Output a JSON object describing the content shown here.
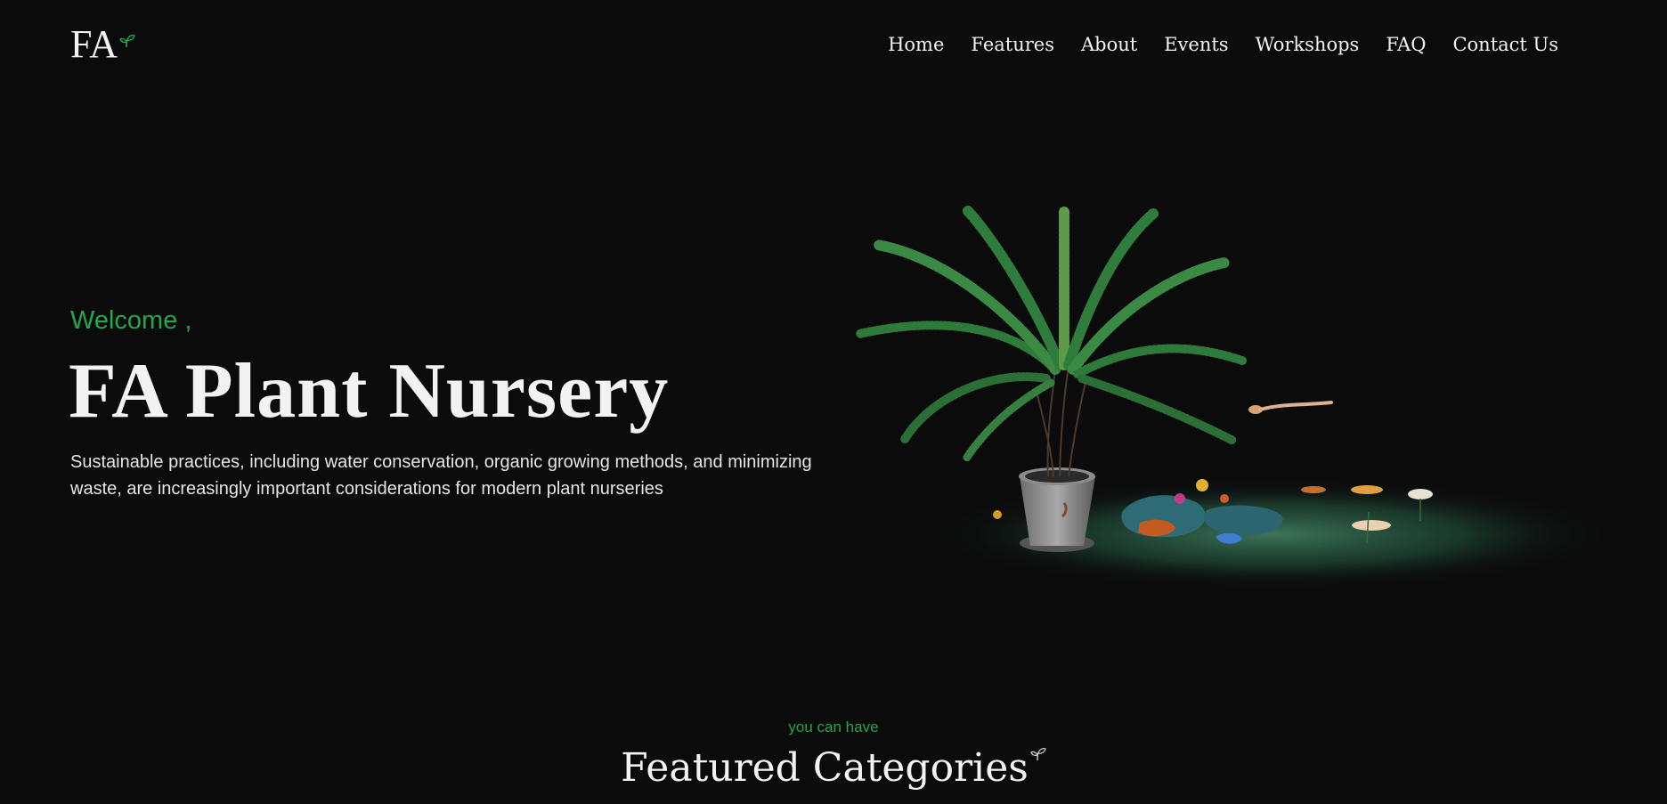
{
  "header": {
    "logo_text": "FA",
    "logo_icon": "sprout-icon",
    "nav": [
      {
        "label": "Home"
      },
      {
        "label": "Features"
      },
      {
        "label": "About"
      },
      {
        "label": "Events"
      },
      {
        "label": "Workshops"
      },
      {
        "label": "FAQ"
      },
      {
        "label": "Contact Us"
      }
    ]
  },
  "hero": {
    "welcome": "Welcome ,",
    "title": "FA Plant Nursery",
    "description": "Sustainable practices, including water conservation, organic growing methods, and minimizing waste, are increasingly important considerations for modern plant nurseries",
    "image": "potted-fern-with-flowers-3d-scene"
  },
  "featured": {
    "subtitle": "you can have",
    "title": "Featured Categories",
    "title_icon": "sprout-icon"
  },
  "colors": {
    "background": "#0b0b0c",
    "accent": "#22a84a",
    "text": "#f2f2f2"
  }
}
